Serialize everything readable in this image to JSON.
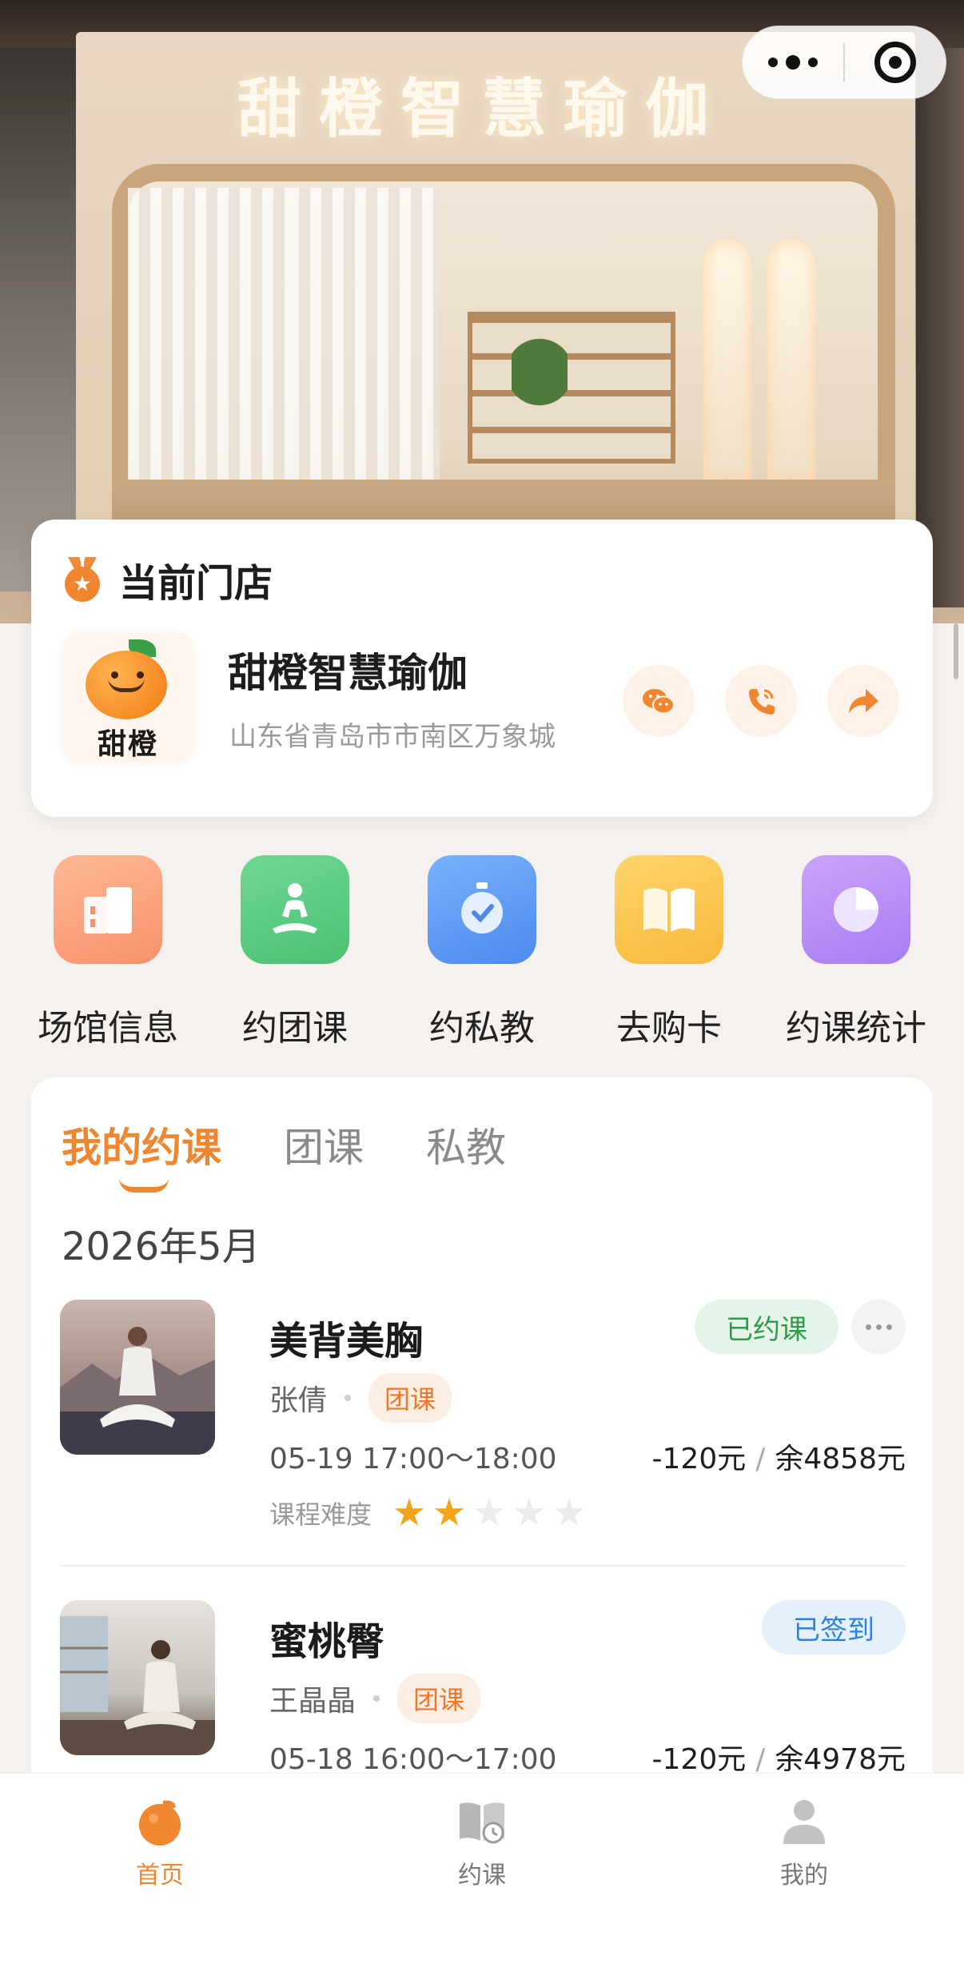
{
  "hero": {
    "sign_text": "甜橙智慧瑜伽"
  },
  "store": {
    "section_title": "当前门店",
    "name": "甜橙智慧瑜伽",
    "address": "山东省青岛市市南区万象城",
    "logo_text": "甜橙"
  },
  "quick_actions": [
    {
      "label": "场馆信息",
      "icon": "building-icon",
      "color": "#f8a27d"
    },
    {
      "label": "约团课",
      "icon": "meditation-icon",
      "color": "#5dcc85"
    },
    {
      "label": "约私教",
      "icon": "stopwatch-icon",
      "color": "#5b9cf5"
    },
    {
      "label": "去购卡",
      "icon": "book-icon",
      "color": "#fbc84e"
    },
    {
      "label": "约课统计",
      "icon": "pie-chart-icon",
      "color": "#b98cf5"
    }
  ],
  "bookings": {
    "tabs": [
      "我的约课",
      "团课",
      "私教"
    ],
    "active_tab": 0,
    "month": "2026年5月",
    "items": [
      {
        "title": "美背美胸",
        "coach": "张倩",
        "tag": "团课",
        "time": "05-19 17:00～18:00",
        "cost": "-120元",
        "balance": "余4858元",
        "difficulty_label": "课程难度",
        "difficulty": 2,
        "difficulty_max": 5,
        "status": "已约课"
      },
      {
        "title": "蜜桃臀",
        "coach": "王晶晶",
        "tag": "团课",
        "time": "05-18 16:00～17:00",
        "cost": "-120元",
        "balance": "余4978元",
        "status": "已签到"
      }
    ]
  },
  "tabbar": [
    {
      "label": "首页",
      "icon": "orange-icon",
      "active": true
    },
    {
      "label": "约课",
      "icon": "book-clock-icon",
      "active": false
    },
    {
      "label": "我的",
      "icon": "person-icon",
      "active": false
    }
  ],
  "colors": {
    "accent": "#f0862f",
    "booked_green": "#2f9a4b",
    "signed_blue": "#2d7fe0"
  }
}
